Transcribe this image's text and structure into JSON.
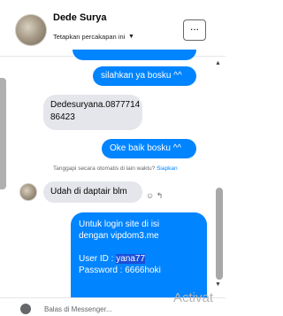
{
  "header": {
    "contact_name": "Dede Surya",
    "subtitle": "Tetapkan percakapan ini",
    "more_label": "..."
  },
  "messages": {
    "m1": "silahkan ya bosku ^^",
    "m2_line1": "Dedesuryana.0877714",
    "m2_line2": "86423",
    "m3": "Oke baik bosku ^^",
    "auto_note": "Tanggapi secara otomatis di lain waktu?",
    "auto_link": "Siapkan",
    "m4": "Udah di daptair blm",
    "m5_line1": "Untuk login site di isi",
    "m5_line2": "dengan vipdom3.me",
    "m5_user_label": "User ID  :",
    "m5_user_value": "yana77",
    "m5_pass": "Password : 6666hoki"
  },
  "composer": {
    "placeholder": "Balas di Messenger..."
  },
  "watermark": "Activat"
}
